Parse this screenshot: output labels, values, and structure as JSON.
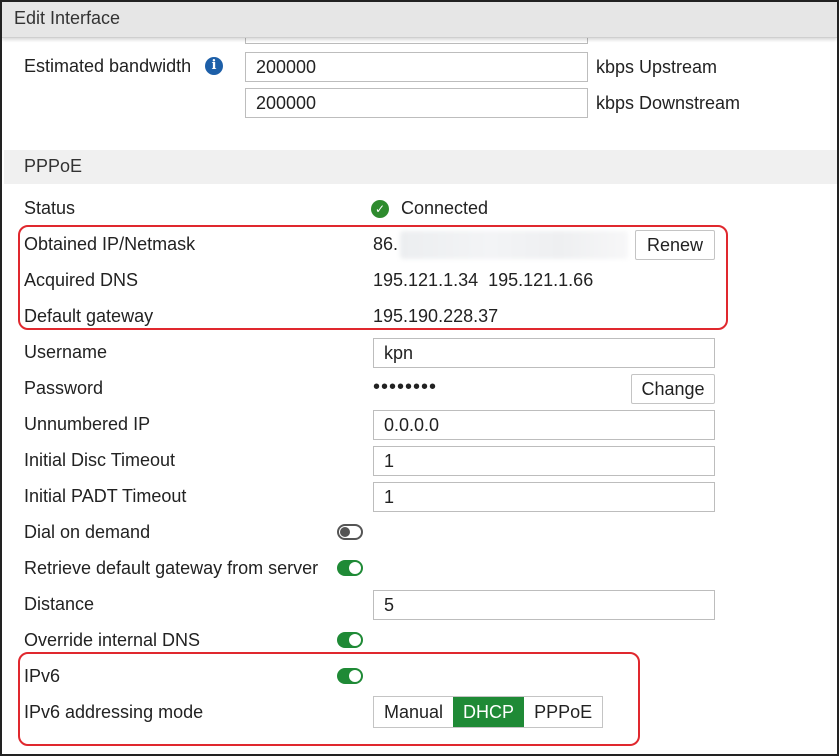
{
  "window": {
    "title": "Edit Interface"
  },
  "bandwidth": {
    "label": "Estimated bandwidth",
    "upstream_value": "200000",
    "upstream_unit": "kbps Upstream",
    "downstream_value": "200000",
    "downstream_unit": "kbps Downstream"
  },
  "pppoe": {
    "section_title": "PPPoE",
    "status_label": "Status",
    "status_value": "Connected",
    "ip_label": "Obtained IP/Netmask",
    "ip_value": "86.",
    "renew_label": "Renew",
    "dns_label": "Acquired DNS",
    "dns_value": "195.121.1.34  195.121.1.66",
    "gateway_label": "Default gateway",
    "gateway_value": "195.190.228.37",
    "username_label": "Username",
    "username_value": "kpn",
    "password_label": "Password",
    "password_value": "••••••••",
    "change_label": "Change",
    "unnumbered_label": "Unnumbered IP",
    "unnumbered_value": "0.0.0.0",
    "disc_timeout_label": "Initial Disc Timeout",
    "disc_timeout_value": "1",
    "padt_timeout_label": "Initial PADT Timeout",
    "padt_timeout_value": "1",
    "dial_on_demand_label": "Dial on demand",
    "dial_on_demand_enabled": false,
    "retrieve_gateway_label": "Retrieve default gateway from server",
    "retrieve_gateway_enabled": true,
    "distance_label": "Distance",
    "distance_value": "5",
    "override_dns_label": "Override internal DNS",
    "override_dns_enabled": true,
    "ipv6_label": "IPv6",
    "ipv6_enabled": true,
    "ipv6_mode_label": "IPv6 addressing mode",
    "ipv6_modes": [
      "Manual",
      "DHCP",
      "PPPoE"
    ],
    "ipv6_mode_selected": "DHCP"
  },
  "colors": {
    "accent_green": "#1f8a36",
    "highlight_red": "#e0282e",
    "info_blue": "#1d5fa8"
  },
  "icons": {
    "info": "info-icon",
    "status": "check-circle-icon"
  }
}
